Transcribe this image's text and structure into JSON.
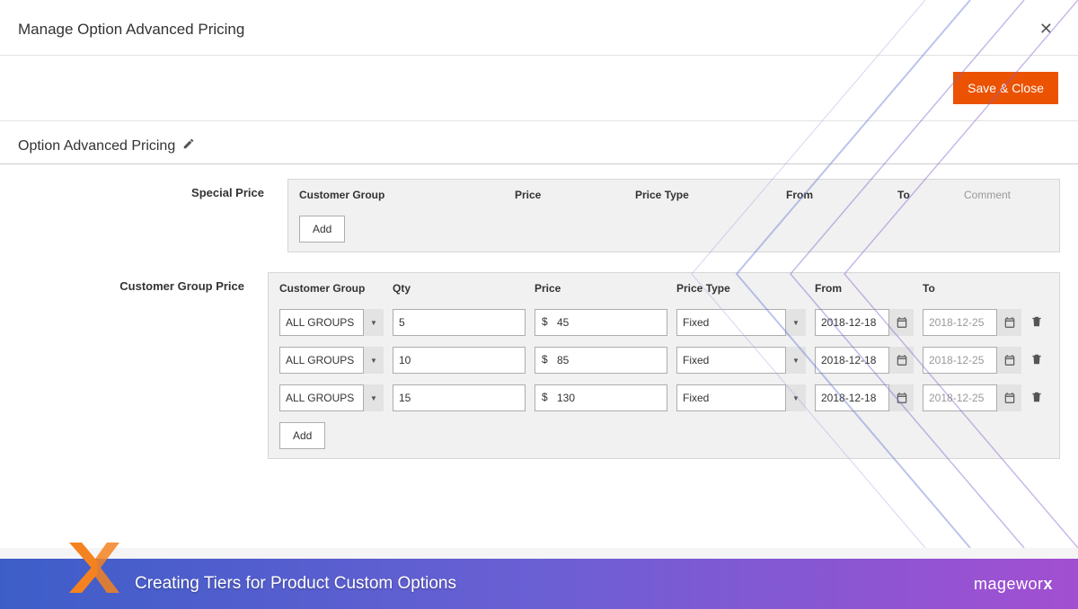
{
  "modal": {
    "title": "Manage Option Advanced Pricing",
    "save_close": "Save & Close"
  },
  "section": {
    "title": "Option Advanced Pricing"
  },
  "specialPrice": {
    "label": "Special Price",
    "headers": {
      "group": "Customer Group",
      "price": "Price",
      "ptype": "Price Type",
      "from": "From",
      "to": "To",
      "comment": "Comment"
    },
    "add": "Add"
  },
  "customerGroupPrice": {
    "label": "Customer Group Price",
    "headers": {
      "group": "Customer Group",
      "qty": "Qty",
      "price": "Price",
      "ptype": "Price Type",
      "from": "From",
      "to": "To"
    },
    "currency": "$",
    "rows": [
      {
        "group": "ALL GROUPS",
        "qty": "5",
        "price": "45",
        "ptype": "Fixed",
        "from": "2018-12-18",
        "to": "2018-12-25"
      },
      {
        "group": "ALL GROUPS",
        "qty": "10",
        "price": "85",
        "ptype": "Fixed",
        "from": "2018-12-18",
        "to": "2018-12-25"
      },
      {
        "group": "ALL GROUPS",
        "qty": "15",
        "price": "130",
        "ptype": "Fixed",
        "from": "2018-12-18",
        "to": "2018-12-25"
      }
    ],
    "add": "Add"
  },
  "banner": {
    "title": "Creating Tiers for Product Custom Options",
    "brand1": "magewor",
    "brand2": "x"
  }
}
